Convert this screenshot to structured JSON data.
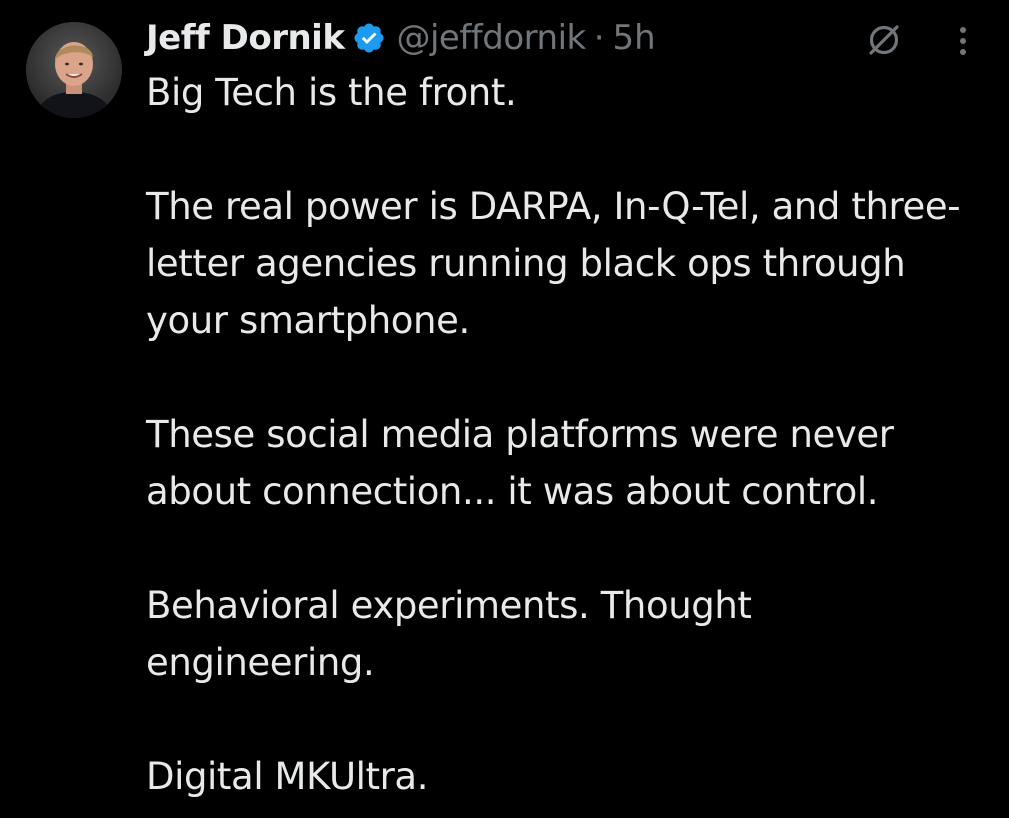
{
  "tweet": {
    "author": {
      "name": "Jeff Dornik",
      "handle": "@jeffdornik",
      "verified": true,
      "avatar_icon": "user-avatar"
    },
    "separator": "·",
    "time": "5h",
    "actions": {
      "grok_icon": "grok-icon",
      "more_icon": "more-vertical-icon"
    },
    "paragraphs": [
      "Big Tech is the front.",
      "The real power is DARPA, In-Q-Tel, and three-letter agencies running black ops through your smartphone.",
      "These social media platforms were never about connection... it was about control.",
      "Behavioral experiments. Thought engineering.",
      "Digital MKUltra."
    ]
  },
  "colors": {
    "background": "#000000",
    "text_primary": "#e7e9ea",
    "text_secondary": "#71767b",
    "verified_blue": "#1d9bf0"
  }
}
